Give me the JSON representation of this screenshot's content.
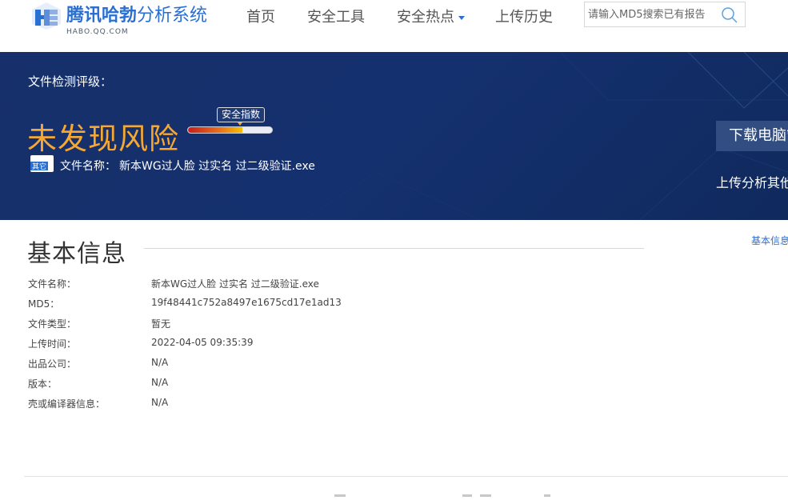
{
  "header": {
    "logo_title_strong": "腾讯哈勃",
    "logo_title_light": "分析系统",
    "logo_sub": "HABO.QQ.COM",
    "nav": [
      {
        "label": "首页"
      },
      {
        "label": "安全工具"
      },
      {
        "label": "安全热点"
      },
      {
        "label": "上传历史"
      }
    ],
    "search": {
      "placeholder": "请输入MD5搜索已有报告",
      "value": ""
    }
  },
  "banner": {
    "rating_label": "文件检测评级：",
    "risk_text": "未发现风险",
    "safety_tag": "安全指数",
    "safety_level_percent": 65,
    "type_badge": "其它",
    "file_label": "文件名称：",
    "file_value": "新本WG过人脸 过实名 过二级验证.exe",
    "download_label": "下载电脑管家",
    "upload_other": "上传分析其他文件"
  },
  "basic_info": {
    "title": "基本信息",
    "side_link": "基本信息",
    "rows": [
      {
        "key": "文件名称：",
        "value": "新本WG过人脸 过实名 过二级验证.exe"
      },
      {
        "key": "MD5：",
        "value": "19f48441c752a8497e1675cd17e1ad13"
      },
      {
        "key": "文件类型：",
        "value": "暂无"
      },
      {
        "key": "上传时间：",
        "value": "2022-04-05 09:35:39"
      },
      {
        "key": "出品公司：",
        "value": "N/A"
      },
      {
        "key": "版本：",
        "value": "N/A"
      },
      {
        "key": "壳或编译器信息：",
        "value": "N/A"
      }
    ]
  },
  "colors": {
    "brand": "#2a6fd2",
    "banner_bg": "#14306e",
    "risk": "#f7a833",
    "download_btn": "#324d82"
  }
}
